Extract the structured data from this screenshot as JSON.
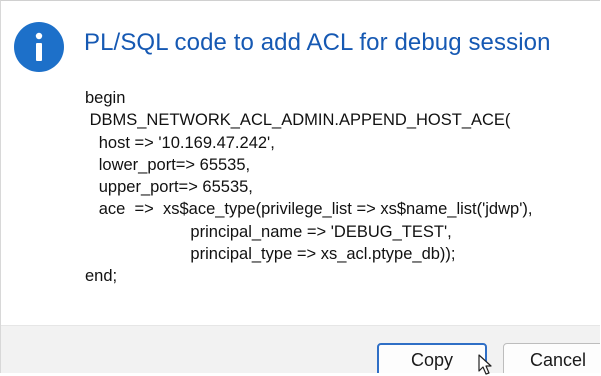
{
  "dialog": {
    "title": "PL/SQL code to add ACL for debug session",
    "icon": "info-icon",
    "accent_color": "#1d70c9",
    "title_color": "#1659b3",
    "code_lines": [
      "begin",
      " DBMS_NETWORK_ACL_ADMIN.APPEND_HOST_ACE(",
      "   host => '10.169.47.242',",
      "   lower_port=> 65535,",
      "   upper_port=> 65535,",
      "   ace  =>  xs$ace_type(privilege_list => xs$name_list('jdwp'),",
      "                       principal_name => 'DEBUG_TEST',",
      "                       principal_type => xs_acl.ptype_db));",
      "end;"
    ]
  },
  "buttons": {
    "copy_label": "Copy",
    "cancel_label": "Cancel"
  }
}
